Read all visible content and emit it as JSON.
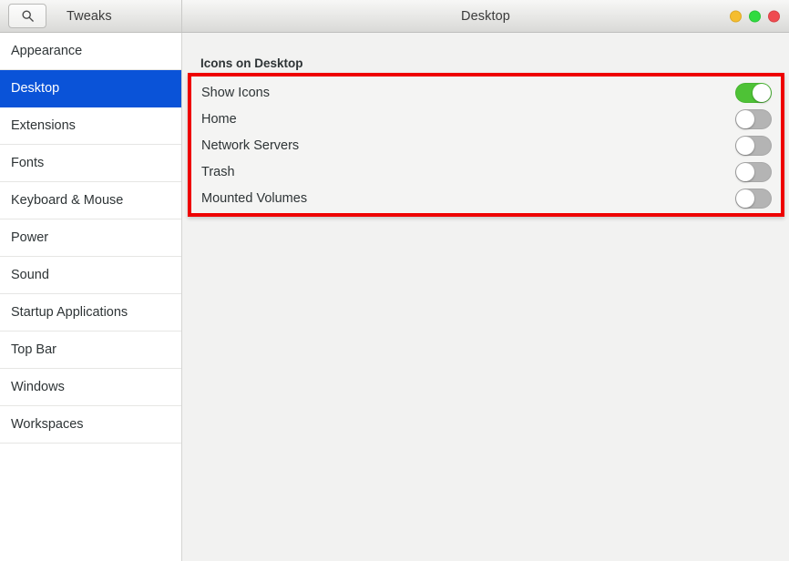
{
  "window": {
    "app_title": "Tweaks",
    "page_title": "Desktop",
    "search_icon": "search-icon",
    "controls": [
      {
        "name": "minimize-button",
        "color": "#f5bd2e"
      },
      {
        "name": "maximize-button",
        "color": "#2fdb3f"
      },
      {
        "name": "close-button",
        "color": "#ef4b50"
      }
    ]
  },
  "sidebar": {
    "items": [
      {
        "label": "Appearance",
        "selected": false
      },
      {
        "label": "Desktop",
        "selected": true
      },
      {
        "label": "Extensions",
        "selected": false
      },
      {
        "label": "Fonts",
        "selected": false
      },
      {
        "label": "Keyboard & Mouse",
        "selected": false
      },
      {
        "label": "Power",
        "selected": false
      },
      {
        "label": "Sound",
        "selected": false
      },
      {
        "label": "Startup Applications",
        "selected": false
      },
      {
        "label": "Top Bar",
        "selected": false
      },
      {
        "label": "Windows",
        "selected": false
      },
      {
        "label": "Workspaces",
        "selected": false
      }
    ]
  },
  "main": {
    "section_title": "Icons on Desktop",
    "settings": [
      {
        "label": "Show Icons",
        "state": "on"
      },
      {
        "label": "Home",
        "state": "off"
      },
      {
        "label": "Network Servers",
        "state": "off"
      },
      {
        "label": "Trash",
        "state": "off"
      },
      {
        "label": "Mounted Volumes",
        "state": "off"
      }
    ]
  },
  "annotation": {
    "name": "highlight-rectangle",
    "color": "#ee0000"
  },
  "colors": {
    "selection_blue": "#0a53d8",
    "toggle_on_green": "#4ec236",
    "toggle_off_gray": "#b4b4b4",
    "annotation_red": "#ee0000"
  }
}
